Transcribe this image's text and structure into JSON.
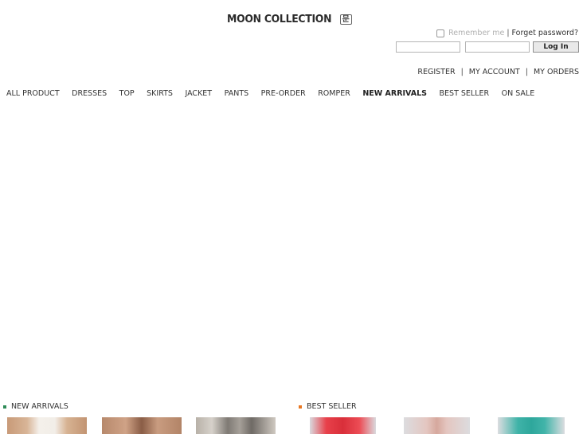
{
  "header": {
    "logo_text": "MOON COLLECTION",
    "logo_mark": "문"
  },
  "login": {
    "remember_label": "Remember me",
    "separator": "|",
    "forget_label": "Forget password?",
    "id_value": "",
    "password_value": "",
    "button_label": "Log In"
  },
  "account_links": {
    "register": "REGISTER",
    "my_account": "MY ACCOUNT",
    "my_orders": "MY ORDERS",
    "separator": "|"
  },
  "nav": {
    "items": [
      {
        "label": "ALL PRODUCT"
      },
      {
        "label": "DRESSES"
      },
      {
        "label": "TOP"
      },
      {
        "label": "SKIRTS"
      },
      {
        "label": "JACKET"
      },
      {
        "label": "PANTS"
      },
      {
        "label": "PRE-ORDER"
      },
      {
        "label": "ROMPER"
      },
      {
        "label": "NEW ARRIVALS"
      },
      {
        "label": "BEST SELLER"
      },
      {
        "label": "ON SALE"
      }
    ]
  },
  "sections": {
    "new_arrivals": {
      "title": "NEW ARRIVALS",
      "bullet_color": "#2e8b57"
    },
    "best_seller": {
      "title": "BEST SELLER",
      "bullet_color": "#e87722"
    }
  },
  "colors": {
    "text": "#333333",
    "input_border": "#b5b5b5",
    "button_bg": "#e9e9e9"
  }
}
